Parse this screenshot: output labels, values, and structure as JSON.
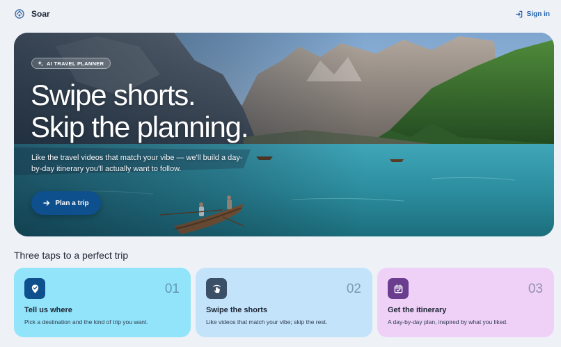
{
  "header": {
    "brand_name": "Soar",
    "signin_label": "Sign in"
  },
  "hero": {
    "badge": "AI TRAVEL PLANNER",
    "headline_line1": "Swipe shorts.",
    "headline_line2": "Skip the planning.",
    "subcopy": "Like the travel videos that match your vibe — we'll build a day-by-day itinerary you'll actually want to follow.",
    "cta_label": "Plan a trip",
    "cta_color": "#0e4f8d"
  },
  "steps": {
    "title": "Three taps to a perfect trip",
    "items": [
      {
        "number": "01",
        "title": "Tell us where",
        "description": "Pick a destination and the kind of trip you want.",
        "icon": "map-pin-icon",
        "color": "#92e4fb"
      },
      {
        "number": "02",
        "title": "Swipe the shorts",
        "description": "Like videos that match your vibe; skip the rest.",
        "icon": "swipe-hand-icon",
        "color": "#c3e3fb"
      },
      {
        "number": "03",
        "title": "Get the itinerary",
        "description": "A day-by-day plan, inspired by what you liked.",
        "icon": "calendar-check-icon",
        "color": "#efd1f8"
      }
    ]
  }
}
